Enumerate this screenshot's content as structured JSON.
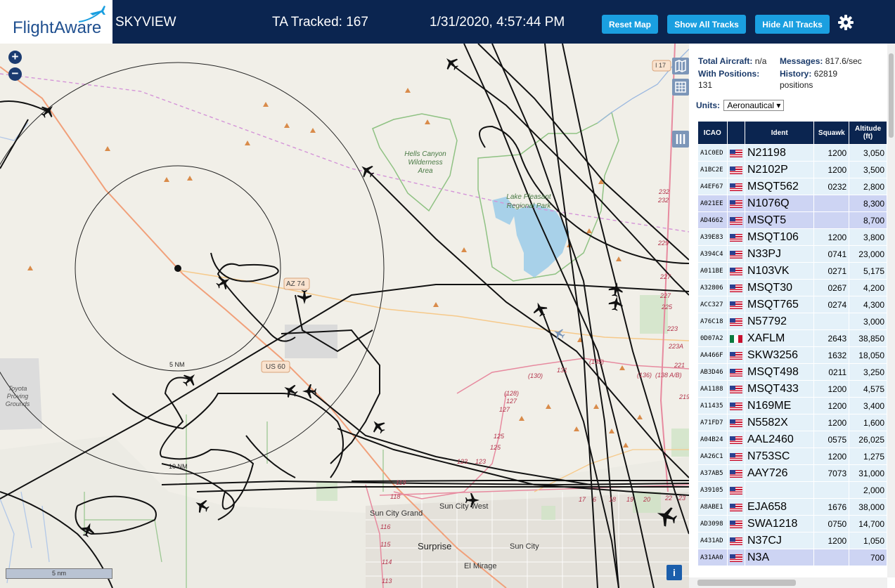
{
  "header": {
    "logo_text": "FlightAware",
    "site_name": "SKYVIEW",
    "ta_tracked": "TA Tracked: 167",
    "datetime": "1/31/2020, 4:57:44 PM",
    "buttons": {
      "reset": "Reset Map",
      "show": "Show All Tracks",
      "hide": "Hide All Tracks"
    },
    "gear_icon": "gear-icon"
  },
  "stats": {
    "total_label": "Total Aircraft:",
    "total_value": "n/a",
    "messages_label": "Messages:",
    "messages_value": "817.6/sec",
    "positions_label": "With Positions:",
    "positions_value": "131",
    "history_label": "History:",
    "history_value": "62819 positions"
  },
  "units": {
    "label": "Units:",
    "selected": "Aeronautical"
  },
  "table": {
    "columns": [
      "ICAO",
      "",
      "Ident",
      "Squawk",
      "Altitude (ft)"
    ],
    "rows": [
      {
        "icao": "A1C0ED",
        "flag": "us",
        "ident": "N21198",
        "squawk": "1200",
        "alt": "3,050",
        "hl": false
      },
      {
        "icao": "A1BC2E",
        "flag": "us",
        "ident": "N2102P",
        "squawk": "1200",
        "alt": "3,500",
        "hl": false
      },
      {
        "icao": "A4EF67",
        "flag": "us",
        "ident": "MSQT562",
        "squawk": "0232",
        "alt": "2,800",
        "hl": false
      },
      {
        "icao": "A021EE",
        "flag": "us",
        "ident": "N1076Q",
        "squawk": "",
        "alt": "8,300",
        "hl": true
      },
      {
        "icao": "AD4662",
        "flag": "us",
        "ident": "MSQT5",
        "squawk": "",
        "alt": "8,700",
        "hl": true
      },
      {
        "icao": "A39E83",
        "flag": "us",
        "ident": "MSQT106",
        "squawk": "1200",
        "alt": "3,800",
        "hl": false
      },
      {
        "icao": "A394C4",
        "flag": "us",
        "ident": "N33PJ",
        "squawk": "0741",
        "alt": "23,000",
        "hl": false
      },
      {
        "icao": "A011BE",
        "flag": "us",
        "ident": "N103VK",
        "squawk": "0271",
        "alt": "5,175",
        "hl": false
      },
      {
        "icao": "A32806",
        "flag": "us",
        "ident": "MSQT30",
        "squawk": "0267",
        "alt": "4,200",
        "hl": false
      },
      {
        "icao": "ACC327",
        "flag": "us",
        "ident": "MSQT765",
        "squawk": "0274",
        "alt": "4,300",
        "hl": false
      },
      {
        "icao": "A76C18",
        "flag": "us",
        "ident": "N57792",
        "squawk": "",
        "alt": "3,000",
        "hl": false
      },
      {
        "icao": "0D07A2",
        "flag": "mx",
        "ident": "XAFLM",
        "squawk": "2643",
        "alt": "38,850",
        "hl": false
      },
      {
        "icao": "AA466F",
        "flag": "us",
        "ident": "SKW3256",
        "squawk": "1632",
        "alt": "18,050",
        "hl": false
      },
      {
        "icao": "AB3D46",
        "flag": "us",
        "ident": "MSQT498",
        "squawk": "0211",
        "alt": "3,250",
        "hl": false
      },
      {
        "icao": "AA1188",
        "flag": "us",
        "ident": "MSQT433",
        "squawk": "1200",
        "alt": "4,575",
        "hl": false
      },
      {
        "icao": "A11435",
        "flag": "us",
        "ident": "N169ME",
        "squawk": "1200",
        "alt": "3,400",
        "hl": false
      },
      {
        "icao": "A71FD7",
        "flag": "us",
        "ident": "N5582X",
        "squawk": "1200",
        "alt": "1,600",
        "hl": false
      },
      {
        "icao": "A04B24",
        "flag": "us",
        "ident": "AAL2460",
        "squawk": "0575",
        "alt": "26,025",
        "hl": false
      },
      {
        "icao": "AA26C1",
        "flag": "us",
        "ident": "N753SC",
        "squawk": "1200",
        "alt": "1,275",
        "hl": false
      },
      {
        "icao": "A37AB5",
        "flag": "us",
        "ident": "AAY726",
        "squawk": "7073",
        "alt": "31,000",
        "hl": false
      },
      {
        "icao": "A39105",
        "flag": "us",
        "ident": "",
        "squawk": "",
        "alt": "2,000",
        "hl": false
      },
      {
        "icao": "A8ABE1",
        "flag": "us",
        "ident": "EJA658",
        "squawk": "1676",
        "alt": "38,000",
        "hl": false
      },
      {
        "icao": "AD3098",
        "flag": "us",
        "ident": "SWA1218",
        "squawk": "0750",
        "alt": "14,700",
        "hl": false
      },
      {
        "icao": "A431AD",
        "flag": "us",
        "ident": "N37CJ",
        "squawk": "1200",
        "alt": "1,050",
        "hl": false
      },
      {
        "icao": "A31AA0",
        "flag": "us",
        "ident": "N3A",
        "squawk": "",
        "alt": "700",
        "hl": true
      }
    ]
  },
  "map": {
    "labels": {
      "hells_canyon": "Hells Canyon Wilderness Area",
      "lake_pleasant": "Lake Pleasant Regional Park",
      "toyota": "Toyota Proving Grounds",
      "az74": "AZ 74",
      "us60": "US 60",
      "i17": "I 17",
      "ring5": "5 NM",
      "ring10": "10 NM",
      "sun_city_grand": "Sun City Grand",
      "sun_city_west": "Sun City West",
      "surprise": "Surprise",
      "sun_city": "Sun City",
      "el_mirage": "El Mirage",
      "scale": "5 nm",
      "r130": "(130)",
      "r128": "(128)",
      "r135": "(135)",
      "r136": "(136)",
      "r138": "(138 A/B)",
      "n131": "131",
      "n127a": "127",
      "n127b": "127",
      "n125a": "125",
      "n125b": "125",
      "n123a": "123",
      "n123b": "123",
      "n119": "119",
      "n118": "118",
      "n116": "116",
      "n115": "115",
      "n114": "114",
      "n113": "113",
      "n232a": "232",
      "n232b": "232",
      "n229": "229",
      "n227a": "227",
      "n227b": "227",
      "n225": "225",
      "n223": "223",
      "n223a": "223A",
      "n221": "221",
      "n219": "219",
      "n17": "17",
      "n6": "6",
      "n18": "18",
      "n19": "19",
      "n20": "20",
      "n22": "22",
      "n23": "23"
    }
  }
}
